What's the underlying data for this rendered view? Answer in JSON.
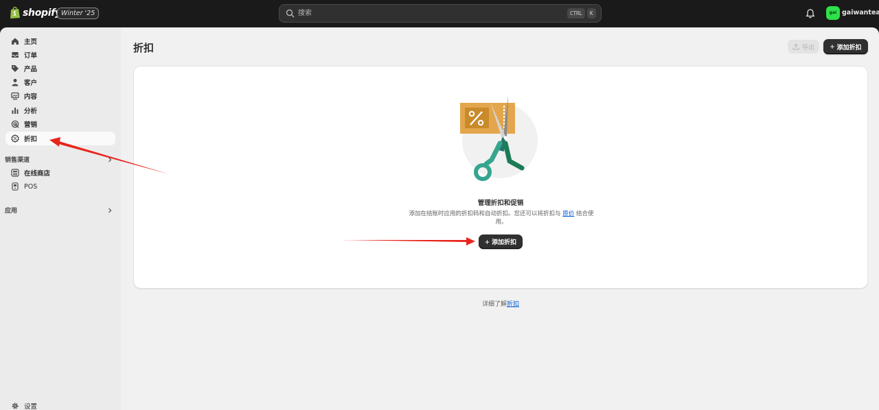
{
  "topbar": {
    "logo_text": "shopify",
    "version_badge": "Winter '25",
    "search_placeholder": "搜索",
    "shortcut_ctrl": "CTRL",
    "shortcut_k": "K",
    "avatar_initials": "gai",
    "store_name": "gaiwantea",
    "avatar_color": "#2ee04a"
  },
  "sidebar": {
    "items": [
      {
        "label": "主页",
        "icon": "home-icon"
      },
      {
        "label": "订单",
        "icon": "inbox-icon"
      },
      {
        "label": "产品",
        "icon": "tag-icon"
      },
      {
        "label": "客户",
        "icon": "person-icon"
      },
      {
        "label": "内容",
        "icon": "content-icon"
      },
      {
        "label": "分析",
        "icon": "chart-icon"
      },
      {
        "label": "营销",
        "icon": "target-icon"
      },
      {
        "label": "折扣",
        "icon": "discount-icon",
        "active": true
      }
    ],
    "sales_channels_label": "销售渠道",
    "channels": [
      {
        "label": "在线商店",
        "icon": "store-icon"
      },
      {
        "label": "POS",
        "icon": "pos-icon"
      }
    ],
    "apps_label": "应用",
    "settings_label": "设置"
  },
  "main": {
    "title": "折扣",
    "export_label": "导出",
    "add_discount_label": "添加折扣",
    "empty_state": {
      "heading": "管理折扣和促销",
      "desc_before": "添加在结账时应用的折扣码和自动折扣。您还可以将折扣与 ",
      "desc_link": "原价",
      "desc_after": " 结合使用。",
      "button_label": "添加折扣"
    },
    "learn_more_prefix": "详细了解",
    "learn_more_link": "折扣"
  },
  "colors": {
    "accent_primary": "#303030",
    "link": "#005bd3",
    "annotation_arrow": "#e8251c"
  }
}
